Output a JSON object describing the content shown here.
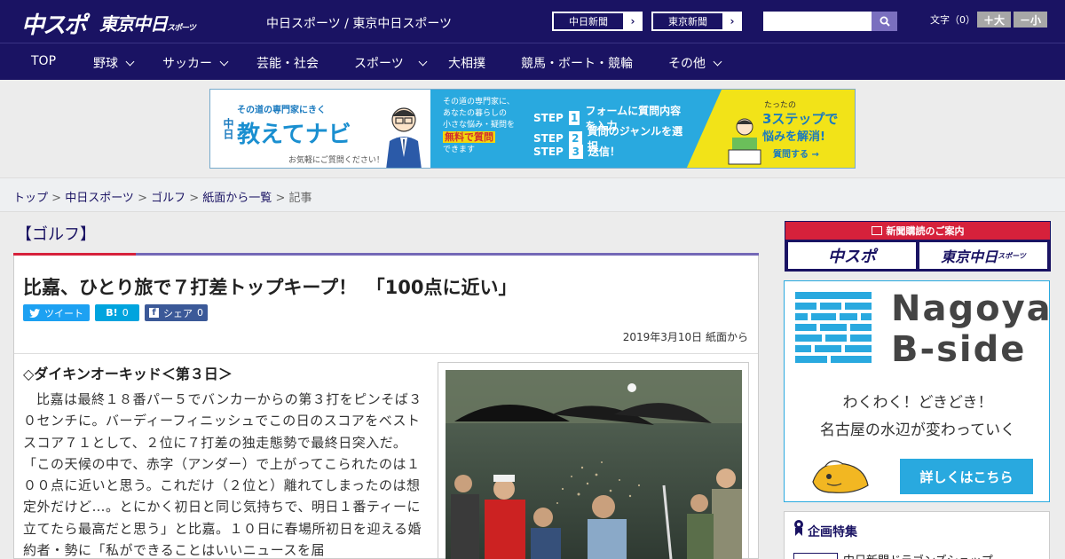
{
  "header": {
    "logo_main": "中スポ",
    "logo_tokyo": "東京中日",
    "logo_tokyo_suffix": "スポーツ",
    "site_title": "中日スポーツ / 東京中日スポーツ",
    "link_chunichi": "中日新聞",
    "link_tokyo": "東京新聞",
    "link_arrow": "›",
    "search_placeholder": "",
    "fontsize_label": "文字（0）",
    "font_larger": "＋大",
    "font_smaller": "－小"
  },
  "nav": {
    "items": [
      {
        "label": "TOP"
      },
      {
        "label": "野球"
      },
      {
        "label": "サッカー"
      },
      {
        "label": "芸能・社会"
      },
      {
        "label": "スポーツ"
      },
      {
        "label": "大相撲"
      },
      {
        "label": "競馬・ボート・競輪"
      },
      {
        "label": "その他"
      }
    ]
  },
  "banner": {
    "tagline": "その道の専門家にきく",
    "brand_prefix": "中日",
    "brand": "教えてナビ",
    "note": "お気軽にご質問ください！",
    "mid_line1": "その道の専門家に、",
    "mid_line2": "あなたの暮らしの",
    "mid_line3": "小さな悩み・疑問を",
    "mid_highlight": "無料で質問",
    "mid_line4": "できます",
    "step_label": "STEP",
    "step1_num": "1",
    "step1": "フォームに質問内容を入力",
    "step2_num": "2",
    "step2": "質問のジャンルを選択",
    "step3_num": "3",
    "step3": "送信！",
    "right_small": "たったの",
    "right_big": "3ステップで",
    "right_big2": "悩みを解消!",
    "right_cta": "質問する →"
  },
  "breadcrumb": {
    "items": [
      "トップ",
      "中日スポーツ",
      "ゴルフ",
      "紙面から一覧"
    ],
    "current": "記事",
    "sep": " > "
  },
  "article": {
    "category": "【ゴルフ】",
    "headline": "比嘉、ひとり旅で７打差トップキープ！　「100点に近い」",
    "tweet": "ツイート",
    "hatena": "B!",
    "hatena_count": "0",
    "share": "シェア",
    "share_count": "0",
    "date": "2019年3月10日 紙面から",
    "subhead": "◇ダイキンオーキッド＜第３日＞",
    "body": "比嘉は最終１８番パー５でバンカーからの第３打をピンそば３０センチに。バーディーフィニッシュでこの日のスコアをベストスコア７１として、２位に７打差の独走態勢で最終日突入だ。「この天候の中で、赤字（アンダー）で上がってこられたのは１００点に近いと思う。これだけ（２位と）離れてしまったのは想定外だけど…。とにかく初日と同じ気持ちで、明日１番ティーに立てたら最高だと思う」と比嘉。１０日に春場所初日を迎える婚約者・勢に「私ができることはいいニュースを届"
  },
  "sidebar": {
    "subscribe_title": "新聞購読のご案内",
    "subscribe_chuspo": "中スポ",
    "subscribe_tokyo": "東京中日",
    "subscribe_tokyo_suffix": "スポーツ",
    "promo_word1": "Nagoya",
    "promo_word2": "B-side",
    "promo_msg1": "わくわく！どきどき！",
    "promo_msg2": "名古屋の水辺が変わっていく",
    "promo_cta": "詳しくはこちら",
    "feature_title": "企画特集",
    "feature_item": "中日新聞ドラゴンズショップ"
  },
  "colors": {
    "brand_navy": "#1a1363",
    "accent_red": "#d6213b",
    "accent_blue": "#29a9df",
    "banner_yellow": "#f2e318"
  }
}
